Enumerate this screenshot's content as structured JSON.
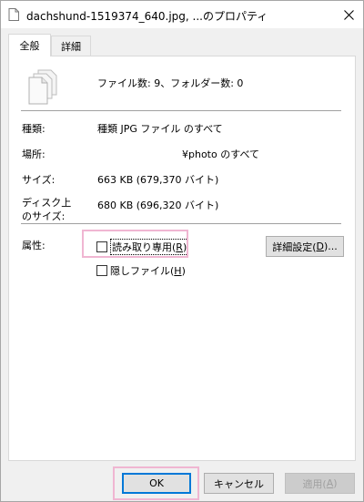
{
  "window": {
    "title": "dachshund-1519374_640.jpg, ...のプロパティ",
    "close_icon": "close-icon"
  },
  "tabs": [
    {
      "label": "全般",
      "active": true
    },
    {
      "label": "詳細",
      "active": false
    }
  ],
  "summary": {
    "text": "ファイル数: 9、フォルダー数: 0",
    "icon": "multiple-files-icon"
  },
  "properties": {
    "type_label": "種類:",
    "type_value": "種類 JPG ファイル のすべて",
    "location_label": "場所:",
    "location_value": "¥photo のすべて",
    "size_label": "サイズ:",
    "size_value": "663 KB (679,370 バイト)",
    "disk_size_label_1": "ディスク上",
    "disk_size_label_2": "のサイズ:",
    "disk_size_value": "680 KB (696,320 バイト)"
  },
  "attributes": {
    "label": "属性:",
    "readonly_label": "読み取り専用(",
    "readonly_key": "R",
    "readonly_close": ")",
    "readonly_checked": false,
    "hidden_label": "隠しファイル(",
    "hidden_key": "H",
    "hidden_close": ")",
    "hidden_checked": false,
    "advanced_label": "詳細設定(",
    "advanced_key": "D",
    "advanced_close": ")..."
  },
  "footer": {
    "ok_label": "OK",
    "cancel_label": "キャンセル",
    "apply_label": "適用(",
    "apply_key": "A",
    "apply_close": ")"
  },
  "colors": {
    "highlight": "#f0b6d2",
    "default_button_border": "#0078d7"
  }
}
